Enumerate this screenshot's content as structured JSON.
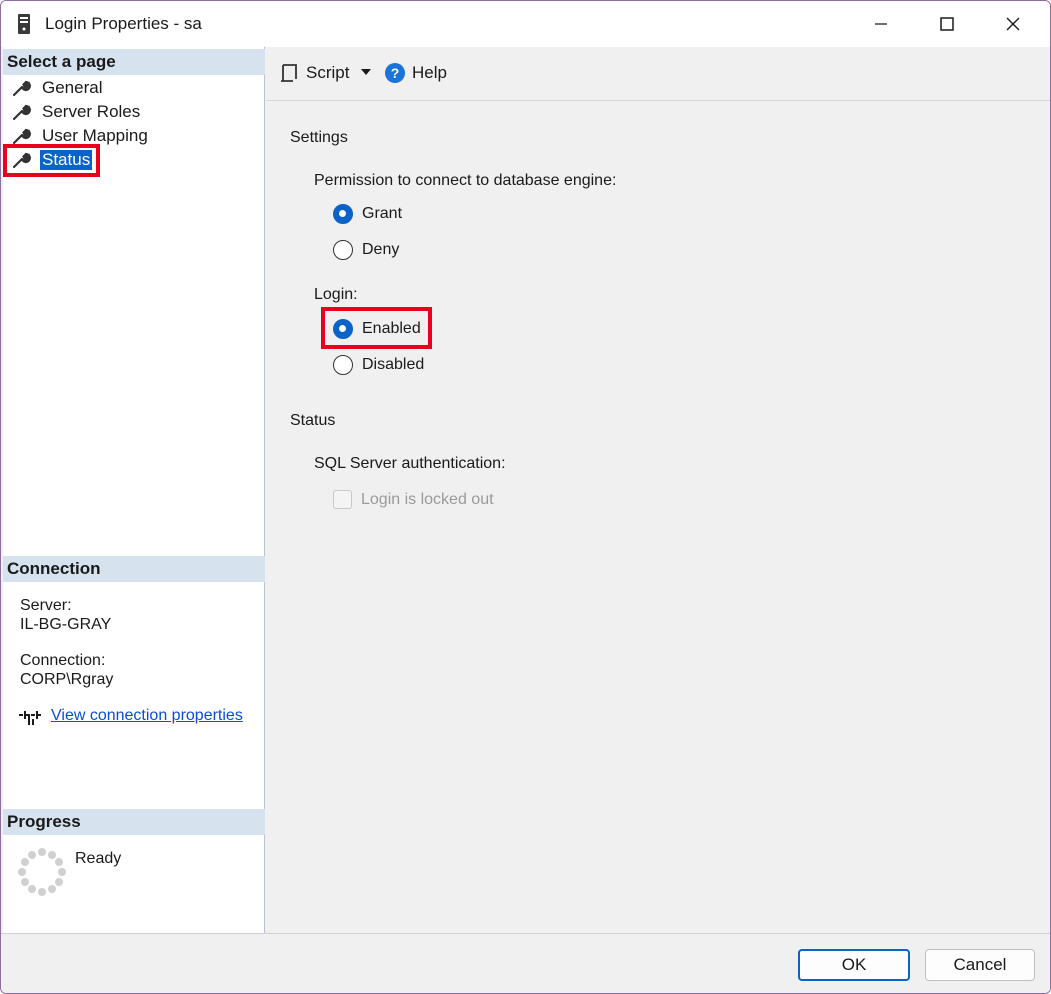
{
  "window": {
    "title": "Login Properties - sa"
  },
  "left": {
    "select_page_header": "Select a page",
    "pages": [
      {
        "label": "General"
      },
      {
        "label": "Server Roles"
      },
      {
        "label": "User Mapping"
      },
      {
        "label": "Status",
        "selected": true
      }
    ],
    "connection_header": "Connection",
    "server_label": "Server:",
    "server_value": "IL-BG-GRAY",
    "connection_label": "Connection:",
    "connection_value": "CORP\\Rgray",
    "view_connection_link": "View connection properties",
    "progress_header": "Progress",
    "progress_status": "Ready"
  },
  "toolbar": {
    "script_label": "Script",
    "help_label": "Help"
  },
  "main": {
    "settings_title": "Settings",
    "permission_label": "Permission to connect to database engine:",
    "permission_options": [
      "Grant",
      "Deny"
    ],
    "permission_selected": "Grant",
    "login_label": "Login:",
    "login_options": [
      "Enabled",
      "Disabled"
    ],
    "login_selected": "Enabled",
    "status_title": "Status",
    "sql_auth_label": "SQL Server authentication:",
    "locked_out_label": "Login is locked out",
    "locked_out_checked": false
  },
  "footer": {
    "ok_label": "OK",
    "cancel_label": "Cancel"
  },
  "colors": {
    "accent": "#0a64c8",
    "highlight": "#e8001c",
    "section_header_bg": "#d6e2ee"
  }
}
